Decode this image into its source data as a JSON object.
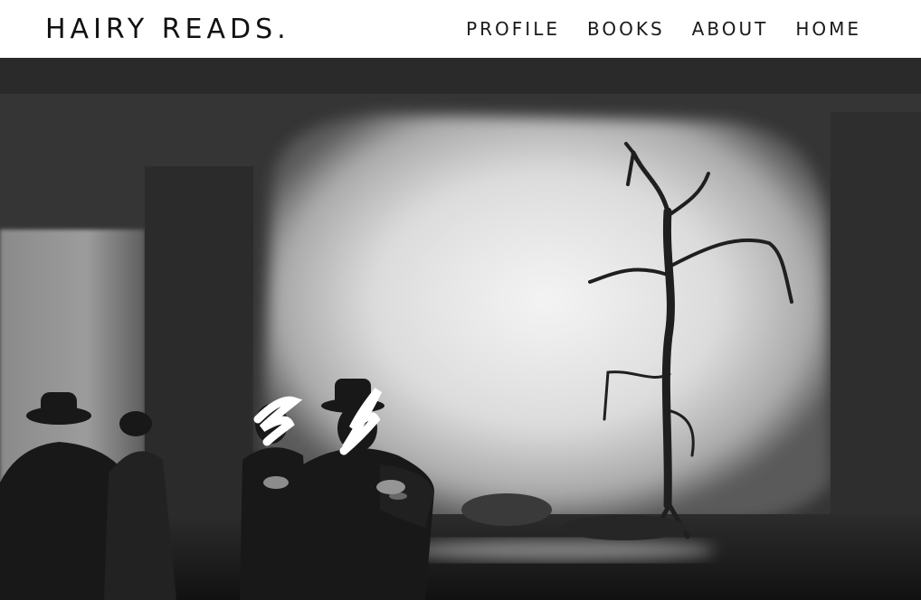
{
  "header": {
    "brand": "HAIRY READS.",
    "nav": [
      {
        "label": "PROFILE"
      },
      {
        "label": "BOOKS"
      },
      {
        "label": "ABOUT"
      },
      {
        "label": "HOME"
      }
    ]
  },
  "hero": {
    "image_subject": "black-and-white stage photograph with seated figures and a bare tree"
  }
}
